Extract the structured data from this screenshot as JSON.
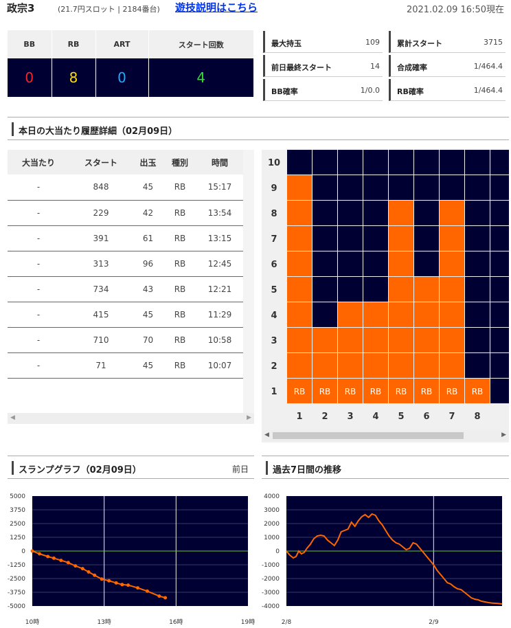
{
  "header": {
    "machine": "政宗3",
    "info": "(21.7円スロット | 2184番台)",
    "link": "遊技説明はこちら",
    "datetime": "2021.02.09 16:50現在"
  },
  "counter": {
    "headers": [
      "BB",
      "RB",
      "ART",
      "スタート回数"
    ],
    "values": [
      "0",
      "8",
      "0",
      "4"
    ],
    "colors": [
      "#ff2222",
      "#ffdd00",
      "#22aaff",
      "#33dd33"
    ]
  },
  "stats": [
    {
      "label": "最大持玉",
      "value": "109"
    },
    {
      "label": "累計スタート",
      "value": "3715"
    },
    {
      "label": "前日最終スタート",
      "value": "14"
    },
    {
      "label": "合成確率",
      "value": "1/464.4"
    },
    {
      "label": "BB確率",
      "value": "1/0.0"
    },
    {
      "label": "RB確率",
      "value": "1/464.4"
    }
  ],
  "history": {
    "title": "本日の大当たり履歴詳細（02月09日）",
    "headers": [
      "大当たり",
      "スタート",
      "出玉",
      "種別",
      "時間"
    ],
    "rows": [
      [
        "-",
        "848",
        "45",
        "RB",
        "15:17"
      ],
      [
        "-",
        "229",
        "42",
        "RB",
        "13:54"
      ],
      [
        "-",
        "391",
        "61",
        "RB",
        "13:15"
      ],
      [
        "-",
        "313",
        "96",
        "RB",
        "12:45"
      ],
      [
        "-",
        "734",
        "43",
        "RB",
        "12:21"
      ],
      [
        "-",
        "415",
        "45",
        "RB",
        "11:29"
      ],
      [
        "-",
        "710",
        "70",
        "RB",
        "10:58"
      ],
      [
        "-",
        "71",
        "45",
        "RB",
        "10:07"
      ]
    ]
  },
  "grid": {
    "row_labels": [
      "10",
      "9",
      "8",
      "7",
      "6",
      "5",
      "4",
      "3",
      "2",
      "1"
    ],
    "col_labels": [
      "1",
      "2",
      "3",
      "4",
      "5",
      "6",
      "7",
      "8"
    ],
    "heights": [
      9,
      3,
      4,
      4,
      8,
      5,
      8,
      1
    ],
    "cell_label": "RB",
    "fill_color": "#ff6600",
    "bg_color": "#000033"
  },
  "slump": {
    "title": "スランプグラフ（02月09日）",
    "right": "前日",
    "chart_data": {
      "type": "line",
      "y_ticks": [
        "5000",
        "3750",
        "2500",
        "1250",
        "0",
        "-1250",
        "-2500",
        "-3750",
        "-5000"
      ],
      "x_ticks": [
        "10時",
        "13時",
        "16時",
        "19時"
      ],
      "ylim": [
        -5000,
        5000
      ],
      "xlim": [
        10,
        19
      ],
      "x": [
        10,
        10.3,
        10.65,
        10.9,
        11.2,
        11.5,
        11.8,
        12.1,
        12.35,
        12.6,
        12.9,
        13.2,
        13.5,
        13.75,
        14.0,
        14.4,
        14.8,
        15.3,
        15.55
      ],
      "y": [
        0,
        -250,
        -500,
        -650,
        -850,
        -1050,
        -1350,
        -1600,
        -1900,
        -2200,
        -2550,
        -2700,
        -2900,
        -3050,
        -3100,
        -3350,
        -3650,
        -4100,
        -4250
      ],
      "series_color": "#ff6600"
    }
  },
  "week": {
    "title": "過去7日間の推移",
    "chart_data": {
      "type": "line",
      "y_ticks": [
        "4000",
        "3000",
        "2000",
        "1000",
        "0",
        "-1000",
        "-2000",
        "-3000",
        "-4000"
      ],
      "x_ticks": [
        "2/8",
        "2/9"
      ],
      "ylim": [
        -4000,
        4000
      ],
      "x": [
        0,
        5,
        10,
        14,
        18,
        22,
        26,
        30,
        35,
        40,
        45,
        50,
        55,
        60,
        65,
        70,
        75,
        80,
        85,
        90,
        95,
        100,
        105,
        110,
        115,
        120,
        125,
        130,
        135,
        140,
        145,
        150,
        155,
        160,
        165,
        170,
        175,
        180,
        185,
        190,
        195,
        200,
        205,
        210,
        215,
        220,
        225,
        230,
        235,
        240,
        245,
        250,
        255,
        260,
        265,
        270,
        275,
        280,
        285,
        290,
        295,
        300,
        305,
        310,
        315
      ],
      "y": [
        0,
        -300,
        -500,
        -400,
        0,
        -200,
        -100,
        200,
        500,
        900,
        1100,
        1150,
        1100,
        800,
        600,
        400,
        800,
        1400,
        1500,
        1600,
        2100,
        1800,
        2200,
        2500,
        2650,
        2450,
        2700,
        2600,
        2200,
        1900,
        1500,
        1100,
        800,
        600,
        500,
        300,
        100,
        200,
        600,
        500,
        200,
        -100,
        -400,
        -700,
        -1000,
        -1400,
        -1700,
        -2000,
        -2300,
        -2400,
        -2600,
        -2750,
        -2800,
        -3000,
        -3200,
        -3400,
        -3500,
        -3550,
        -3650,
        -3700,
        -3750,
        -3780,
        -3800,
        -3820,
        -3850
      ],
      "x_tick_positions": [
        0,
        215
      ],
      "x_max": 315,
      "series_color": "#ff6600"
    }
  }
}
